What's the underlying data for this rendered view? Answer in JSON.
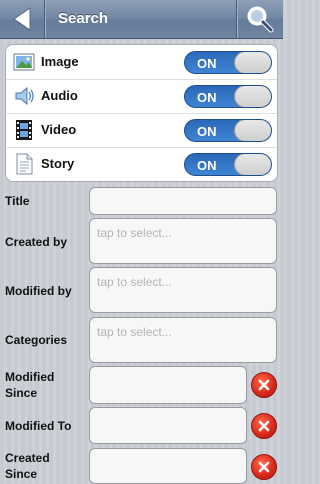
{
  "header": {
    "title": "Search",
    "back_icon": "back-arrow-icon",
    "search_icon": "magnifier-icon"
  },
  "media_types": [
    {
      "label": "Image",
      "icon": "image-icon",
      "toggle": "ON"
    },
    {
      "label": "Audio",
      "icon": "speaker-icon",
      "toggle": "ON"
    },
    {
      "label": "Video",
      "icon": "film-icon",
      "toggle": "ON"
    },
    {
      "label": "Story",
      "icon": "document-icon",
      "toggle": "ON"
    }
  ],
  "form": {
    "title": {
      "label": "Title",
      "value": ""
    },
    "created_by": {
      "label": "Created by",
      "placeholder": "tap to select..."
    },
    "modified_by": {
      "label": "Modified by",
      "placeholder": "tap to select..."
    },
    "categories": {
      "label": "Categories",
      "placeholder": "tap to select..."
    },
    "modified_since": {
      "label_line1": "Modified",
      "label_line2": "Since",
      "value": ""
    },
    "modified_to": {
      "label": "Modified To",
      "value": ""
    },
    "created_since": {
      "label_line1": "Created",
      "label_line2": "Since",
      "value": ""
    }
  },
  "colors": {
    "header": "#6f85a2",
    "toggle_on": "#3275c6",
    "clear_button": "#d8261a"
  }
}
